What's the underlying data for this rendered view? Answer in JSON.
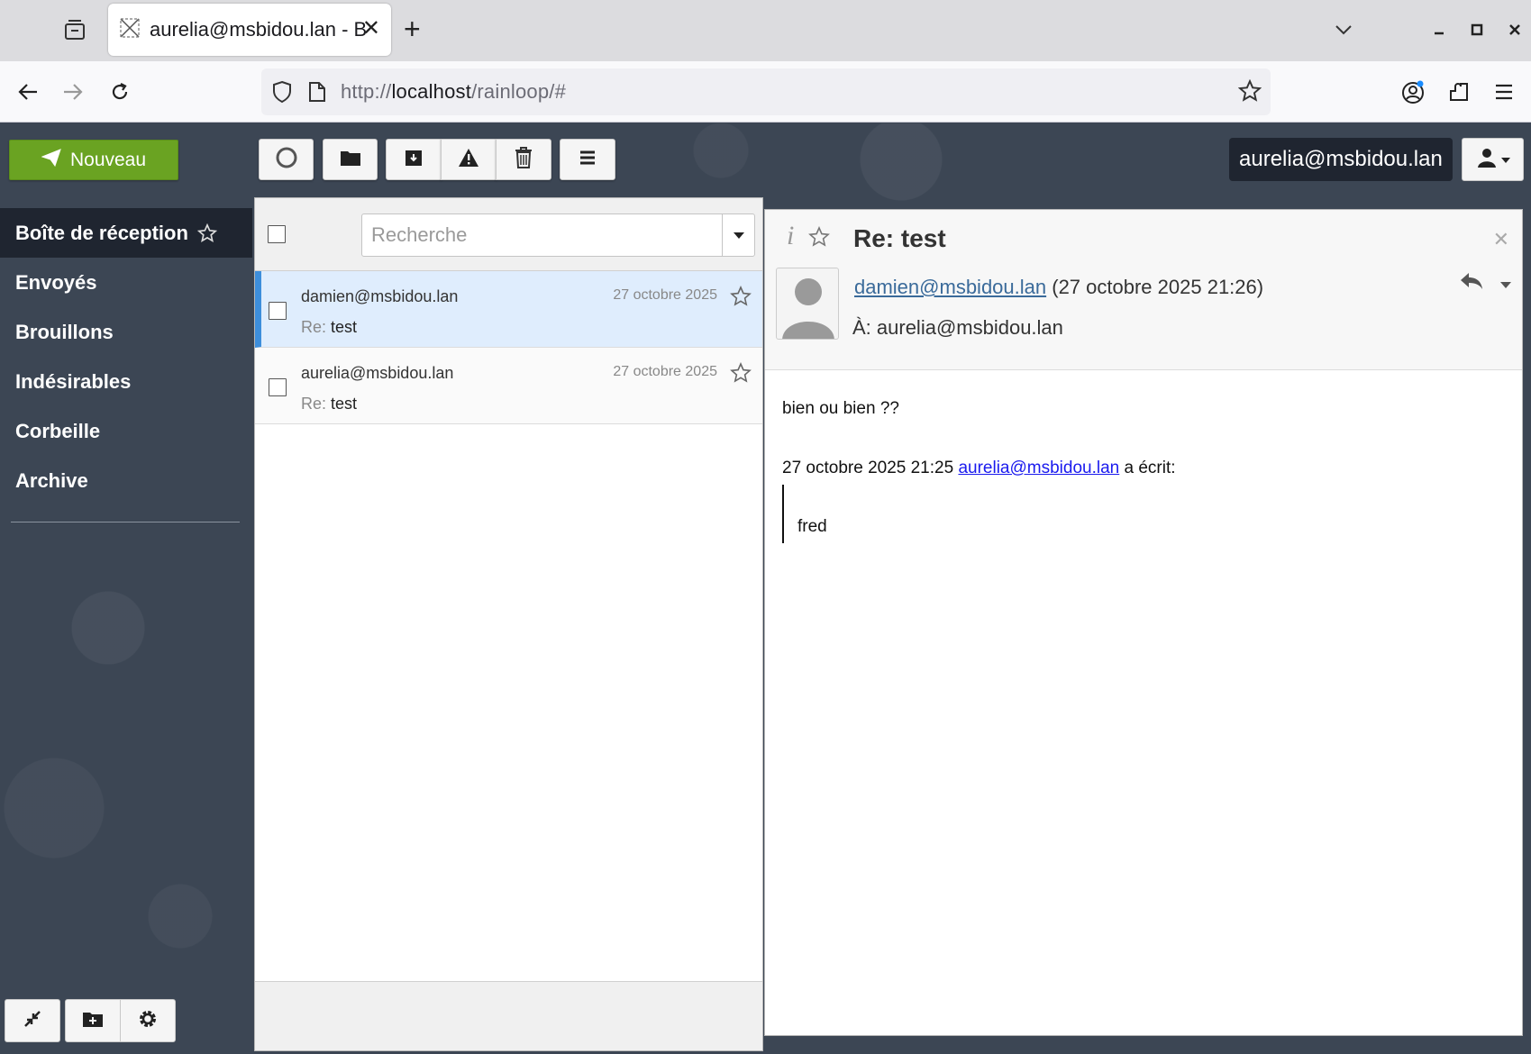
{
  "browser": {
    "tab_title": "aurelia@msbidou.lan - Boîte de réception",
    "url_prefix": "http://",
    "url_host": "localhost",
    "url_path": "/rainloop/#"
  },
  "toolbar": {
    "new_label": "Nouveau",
    "account": "aurelia@msbidou.lan"
  },
  "folders": [
    {
      "label": "Boîte de réception",
      "active": true
    },
    {
      "label": "Envoyés"
    },
    {
      "label": "Brouillons"
    },
    {
      "label": "Indésirables"
    },
    {
      "label": "Corbeille"
    },
    {
      "label": "Archive"
    }
  ],
  "search": {
    "placeholder": "Recherche"
  },
  "messages": [
    {
      "from": "damien@msbidou.lan",
      "date": "27 octobre 2025",
      "re": "Re:",
      "subject": "test"
    },
    {
      "from": "aurelia@msbidou.lan",
      "date": "27 octobre 2025",
      "re": "Re:",
      "subject": "test"
    }
  ],
  "reader": {
    "subject": "Re: test",
    "from_link": "damien@msbidou.lan",
    "from_date": "(27 octobre 2025 21:26)",
    "to": "À: aurelia@msbidou.lan",
    "body_line1": "bien ou bien ??",
    "quote_intro_date": "27 octobre 2025 21:25",
    "quote_intro_link": "aurelia@msbidou.lan",
    "quote_intro_suffix": "a écrit:",
    "quote_text": "fred"
  },
  "colors": {
    "new_button": "#6aa322",
    "selected_accent": "#3d8edb",
    "background": "#3c4654"
  }
}
